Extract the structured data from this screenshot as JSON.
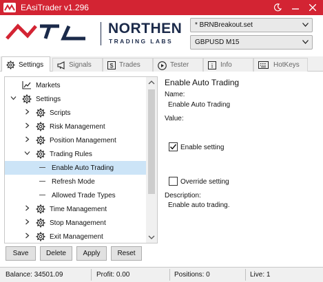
{
  "window": {
    "title": "EAsiTrader v1.296",
    "accent_color": "#d32433",
    "controls": [
      "moon-icon",
      "minimize-icon",
      "close-icon"
    ]
  },
  "header": {
    "brand_name": "NORTHEN",
    "brand_sub": "TRADING LABS",
    "brand_color": "#1b2a4a",
    "setfile_value": "* BRNBreakout.set",
    "symbol_value": "GBPUSD M15"
  },
  "tabs": [
    {
      "label": "Settings",
      "icon": "gear-icon",
      "active": true
    },
    {
      "label": "Signals",
      "icon": "megaphone-icon",
      "active": false
    },
    {
      "label": "Trades",
      "icon": "dollar-icon",
      "active": false
    },
    {
      "label": "Tester",
      "icon": "play-circle-icon",
      "active": false
    },
    {
      "label": "Info",
      "icon": "info-icon",
      "active": false
    },
    {
      "label": "HotKeys",
      "icon": "keyboard-icon",
      "active": false
    }
  ],
  "tree": {
    "items": [
      {
        "label": "Markets",
        "level": 0,
        "expander": "none",
        "icon": "chart-line-icon",
        "selected": false
      },
      {
        "label": "Settings",
        "level": 0,
        "expander": "expanded",
        "icon": "gear-icon",
        "selected": false
      },
      {
        "label": "Scripts",
        "level": 1,
        "expander": "collapsed",
        "icon": "gear-icon",
        "selected": false
      },
      {
        "label": "Risk Management",
        "level": 1,
        "expander": "collapsed",
        "icon": "gear-icon",
        "selected": false
      },
      {
        "label": "Position Management",
        "level": 1,
        "expander": "collapsed",
        "icon": "gear-icon",
        "selected": false
      },
      {
        "label": "Trading Rules",
        "level": 1,
        "expander": "expanded",
        "icon": "gear-icon",
        "selected": false
      },
      {
        "label": "Enable Auto Trading",
        "level": 2,
        "expander": "none",
        "icon": "dash",
        "selected": true
      },
      {
        "label": "Refresh Mode",
        "level": 2,
        "expander": "none",
        "icon": "dash",
        "selected": false
      },
      {
        "label": "Allowed Trade Types",
        "level": 2,
        "expander": "none",
        "icon": "dash",
        "selected": false
      },
      {
        "label": "Time Management",
        "level": 1,
        "expander": "collapsed",
        "icon": "gear-icon",
        "selected": false
      },
      {
        "label": "Stop Management",
        "level": 1,
        "expander": "collapsed",
        "icon": "gear-icon",
        "selected": false
      },
      {
        "label": "Exit Management",
        "level": 1,
        "expander": "collapsed",
        "icon": "gear-icon",
        "selected": false
      }
    ]
  },
  "details": {
    "title": "Enable Auto Trading",
    "name_label": "Name:",
    "name_value": "Enable Auto Trading",
    "value_label": "Value:",
    "enable_setting_label": "Enable setting",
    "enable_setting_checked": true,
    "override_setting_label": "Override setting",
    "override_setting_checked": false,
    "description_label": "Description:",
    "description_value": "Enable auto trading."
  },
  "buttons": {
    "save": "Save",
    "delete": "Delete",
    "apply": "Apply",
    "reset": "Reset"
  },
  "status": {
    "balance": "Balance: 34501.09",
    "profit": "Profit: 0.00",
    "positions": "Positions: 0",
    "live": "Live: 1"
  }
}
